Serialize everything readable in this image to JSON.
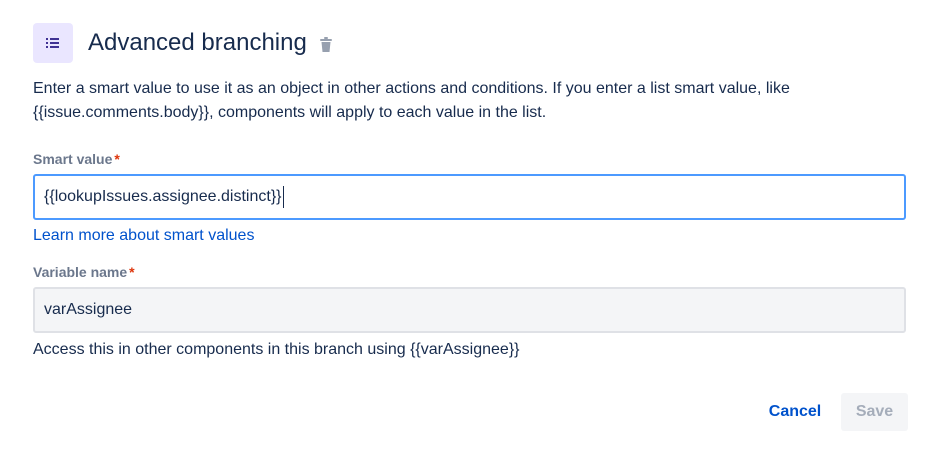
{
  "header": {
    "icon": "list-icon",
    "title": "Advanced branching",
    "delete_icon": "trash-icon"
  },
  "description": "Enter a smart value to use it as an object in other actions and conditions. If you enter a list smart value, like {{issue.comments.body}}, components will apply to each value in the list.",
  "smart_value": {
    "label": "Smart value",
    "required_marker": "*",
    "value": "{{lookupIssues.assignee.distinct}}",
    "link_text": "Learn more about smart values"
  },
  "variable_name": {
    "label": "Variable name",
    "required_marker": "*",
    "value": "varAssignee",
    "help_text": "Access this in other components in this branch using {{varAssignee}}"
  },
  "actions": {
    "cancel_label": "Cancel",
    "save_label": "Save"
  },
  "colors": {
    "accent": "#0052cc",
    "focus_border": "#4c9aff",
    "icon_bg": "#eae6ff",
    "required": "#de350b"
  }
}
